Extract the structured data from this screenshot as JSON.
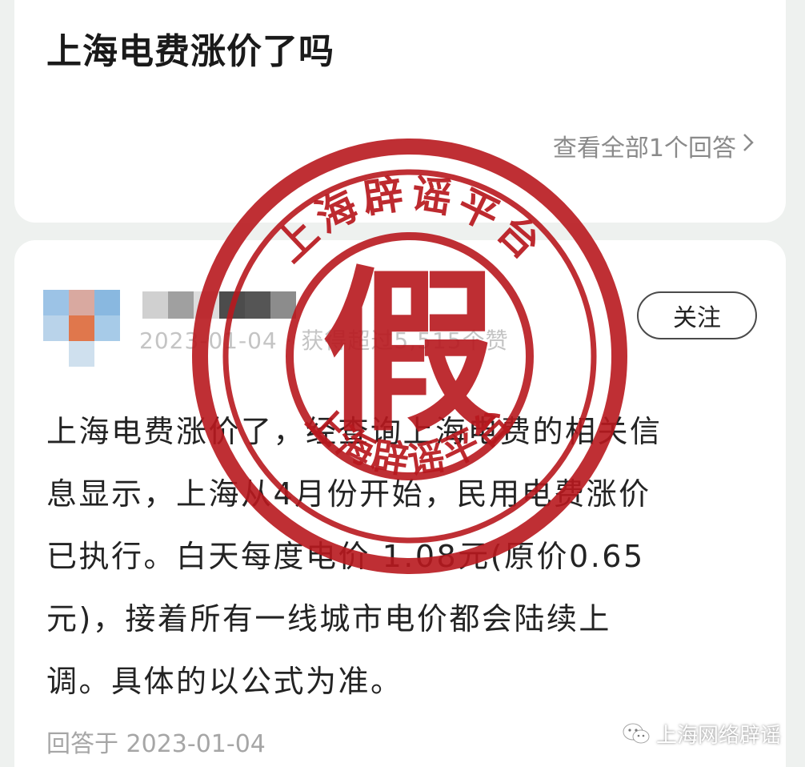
{
  "question": {
    "title": "上海电费涨价了吗",
    "view_all": "查看全部1个回答",
    "view_all_chevron": "chevron-right-icon"
  },
  "answer": {
    "meta": "2023-01-04 · 获得超过5,515个赞",
    "follow_label": "关注",
    "body_lines": [
      "上海电费涨价了，经查询上海电费的相关信",
      "息显示，上海从4月份开始，民用电费涨价",
      "已执行。白天每度电价 1.08元(原价0.65",
      "元)，接着所有一线城市电价都会陆续上",
      "调。具体的以公式为准。"
    ],
    "answered_at": "回答于 2023-01-04"
  },
  "stamp": {
    "top_text": "上海辟谣平台",
    "center_char": "假",
    "bottom_text": "上海辟谣平台",
    "color": "#b8181e"
  },
  "watermark": {
    "text": "上海网络辟谣",
    "icon": "wechat-icon"
  },
  "colors": {
    "background": "#eef1ef",
    "card": "#ffffff",
    "title": "#1a1a1a",
    "muted": "#8a8a8a"
  }
}
